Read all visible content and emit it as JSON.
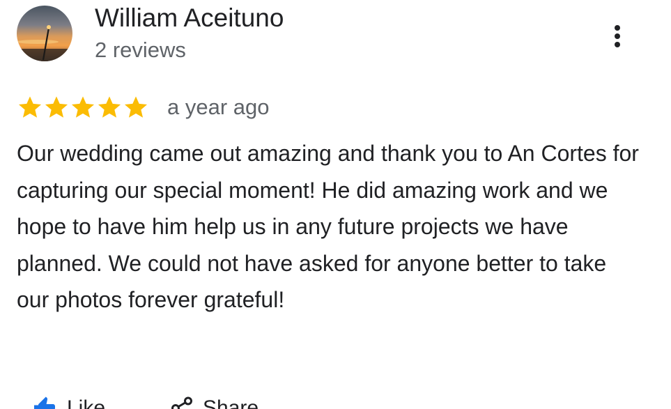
{
  "review": {
    "reviewer_name": "William Aceituno",
    "review_count": "2 reviews",
    "rating": 5,
    "rating_max": 5,
    "date": "a year ago",
    "text": "Our wedding came out amazing and thank you to An Cortes for capturing our special moment! He did amazing work and we hope to have him help us in any future projects we have planned. We could not have asked for anyone better to take our photos forever grateful!"
  },
  "actions": {
    "like_label": "Like",
    "share_label": "Share",
    "more_icon": "more-vert-icon",
    "like_icon": "thumb-up-icon",
    "share_icon": "share-icon"
  },
  "colors": {
    "star": "#fbbc04",
    "primary_text": "#202124",
    "secondary_text": "#5f6368"
  }
}
